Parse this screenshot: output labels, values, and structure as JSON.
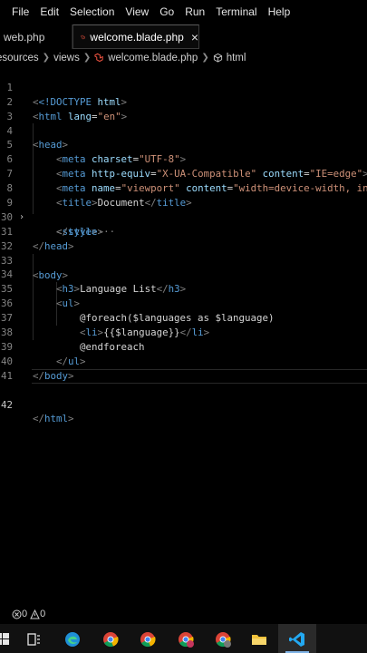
{
  "menu": [
    "File",
    "Edit",
    "Selection",
    "View",
    "Go",
    "Run",
    "Terminal",
    "Help"
  ],
  "tabs": [
    {
      "label": "web.php"
    },
    {
      "label": "welcome.blade.php",
      "close": "×"
    }
  ],
  "breadcrumb": [
    "esources",
    "views",
    "welcome.blade.php",
    "html"
  ],
  "status": {
    "errors": "0",
    "warnings": "0"
  },
  "code": {
    "l1": {
      "num": "1",
      "doctype": "<!DOCTYPE",
      "html": " html",
      "close": ">"
    },
    "l2": {
      "num": "2",
      "open": "<",
      "tag": "html",
      "attr": " lang",
      "eq": "=",
      "val": "\"en\"",
      "close": ">"
    },
    "l3": {
      "num": "3"
    },
    "l4": {
      "num": "4",
      "open": "<",
      "tag": "head",
      "close": ">"
    },
    "l5": {
      "num": "5",
      "open": "<",
      "tag": "meta",
      "attr": " charset",
      "eq": "=",
      "val": "\"UTF-8\"",
      "close": ">"
    },
    "l6": {
      "num": "6",
      "open": "<",
      "tag": "meta",
      "attr": " http-equiv",
      "eq": "=",
      "val": "\"X-UA-Compatible\"",
      "attr2": " content",
      "eq2": "=",
      "val2": "\"IE=edge\"",
      "close": ">"
    },
    "l7": {
      "num": "7",
      "open": "<",
      "tag": "meta",
      "attr": " name",
      "eq": "=",
      "val": "\"viewport\"",
      "attr2": " content",
      "eq2": "=",
      "val2": "\"width=device-width, ini"
    },
    "l8": {
      "num": "8",
      "open": "<",
      "tag": "title",
      "close": ">",
      "text": "Document",
      "open2": "</",
      "tag2": "title",
      "close2": ">"
    },
    "l9": {
      "num": "9",
      "fold": "›",
      "open": "<",
      "tag": "style",
      "close": ">",
      "ellipsis": "···"
    },
    "l30": {
      "num": "30",
      "open": "</",
      "tag": "style",
      "close": ">"
    },
    "l31": {
      "num": "31",
      "open": "</",
      "tag": "head",
      "close": ">"
    },
    "l32": {
      "num": "32"
    },
    "l33": {
      "num": "33",
      "open": "<",
      "tag": "body",
      "close": ">"
    },
    "l34": {
      "num": "34",
      "open": "<",
      "tag": "h3",
      "close": ">",
      "text": "Language List",
      "open2": "</",
      "tag2": "h3",
      "close2": ">"
    },
    "l35": {
      "num": "35",
      "open": "<",
      "tag": "ul",
      "close": ">"
    },
    "l36": {
      "num": "36",
      "text": "@foreach($languages as $language)"
    },
    "l37": {
      "num": "37",
      "open": "<",
      "tag": "li",
      "close": ">",
      "text": "{{$language}}",
      "open2": "</",
      "tag2": "li",
      "close2": ">"
    },
    "l38": {
      "num": "38",
      "text": "@endforeach"
    },
    "l39": {
      "num": "39",
      "open": "</",
      "tag": "ul",
      "close": ">"
    },
    "l40": {
      "num": "40",
      "open": "</",
      "tag": "body",
      "close": ">"
    },
    "l41": {
      "num": "41"
    },
    "l42": {
      "num": "42",
      "open": "</",
      "tag": "html",
      "close": ">"
    }
  },
  "colors": {
    "accent_blade": "#f05340",
    "vscode_blue": "#23a9f2",
    "chrome_red": "#db4437",
    "chrome_green": "#0f9d58",
    "chrome_yellow": "#f4b400"
  },
  "taskbar": [
    "windows-start-icon",
    "task-view-icon",
    "edge-icon",
    "chrome-icon",
    "chrome-icon",
    "chrome-icon",
    "chrome-icon",
    "file-explorer-icon",
    "vscode-icon"
  ]
}
